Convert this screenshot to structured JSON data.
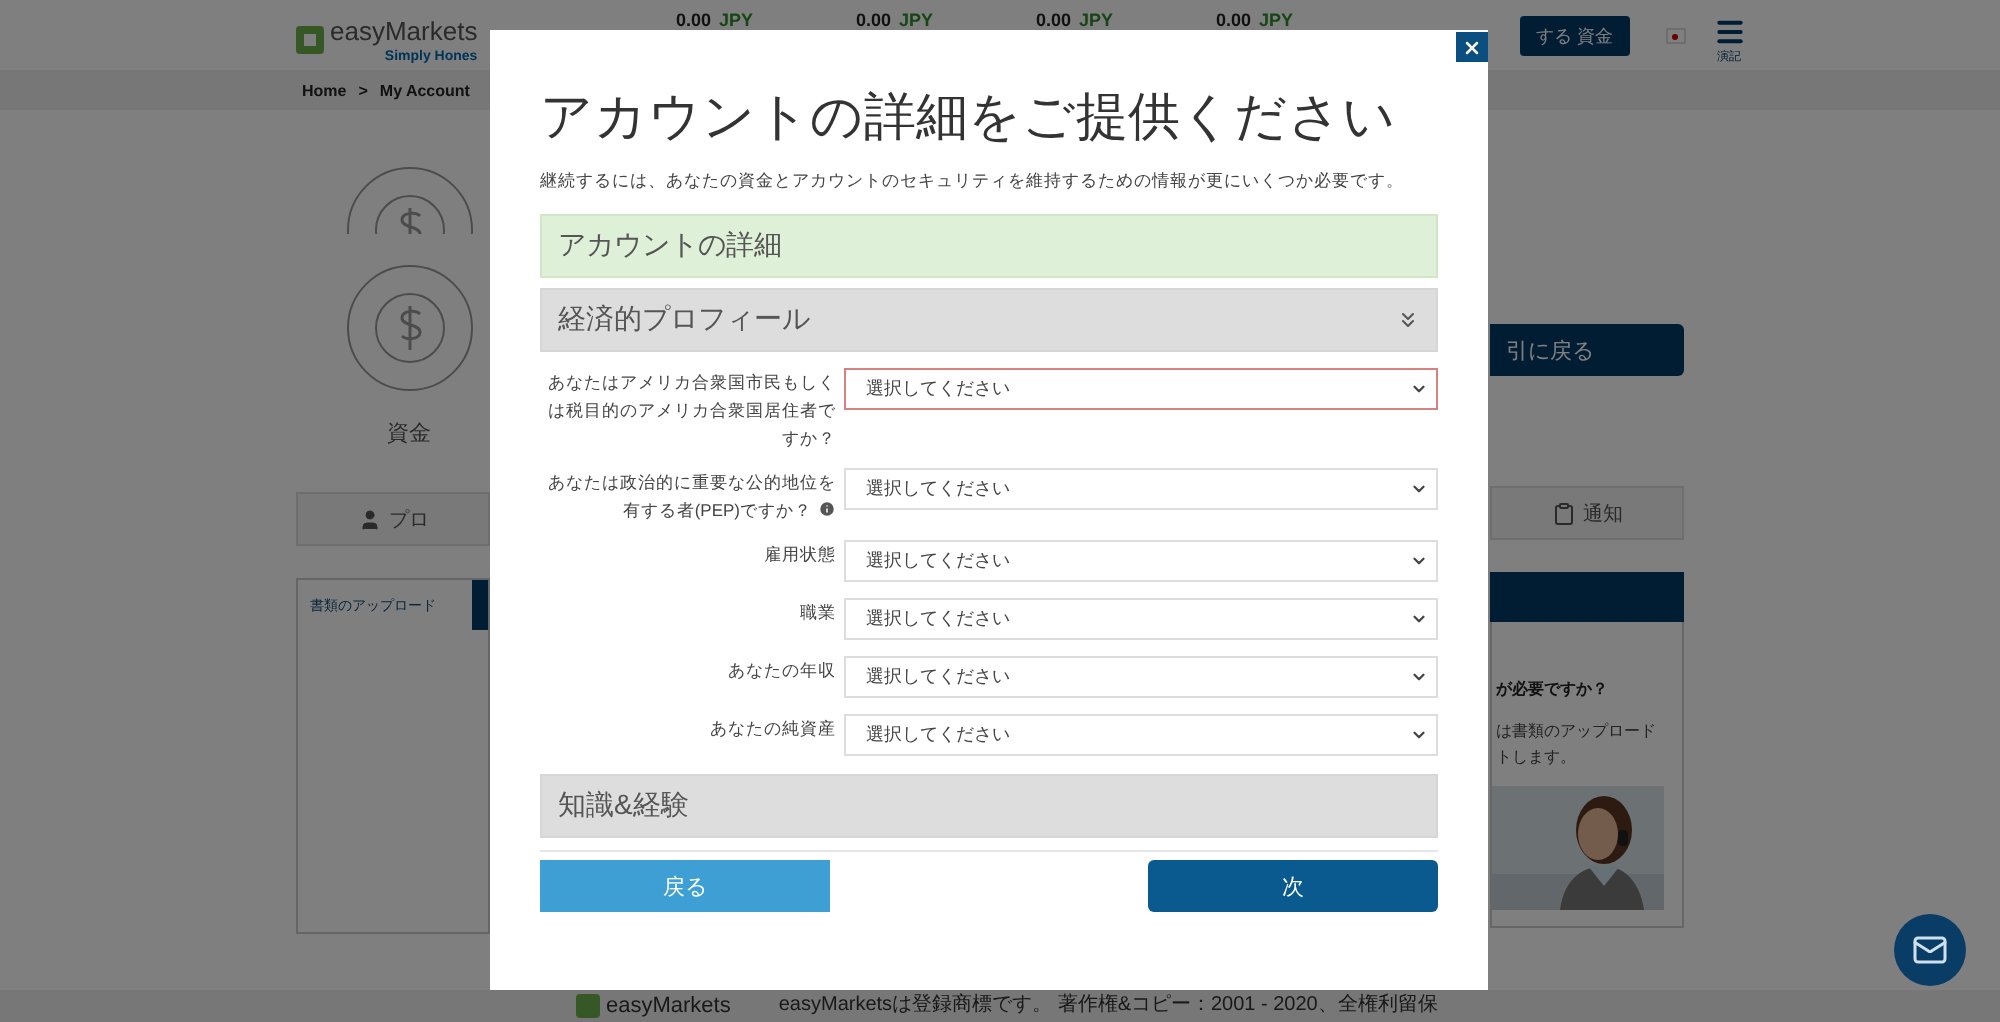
{
  "header": {
    "logo": {
      "name": "easyMarkets",
      "tagline": "Simply Hones"
    },
    "tickers": [
      {
        "value": "0.00",
        "currency": "JPY"
      },
      {
        "value": "0.00",
        "currency": "JPY"
      },
      {
        "value": "0.00",
        "currency": "JPY"
      },
      {
        "value": "0.00",
        "currency": "JPY"
      }
    ],
    "deposit_button": "する 資金",
    "menu_label": "演記"
  },
  "breadcrumb": {
    "items": [
      "Home",
      "My Account"
    ],
    "separator": ">"
  },
  "left": {
    "funds_label": "資金",
    "profile_tab": "プロ",
    "upload_tab": "書類のアップロード"
  },
  "right": {
    "back_button": "引に戻る",
    "notifications_tab": "通知",
    "help_title": "が必要ですか？",
    "help_lines": [
      "は書類のアップロード",
      "トします。"
    ]
  },
  "footer": {
    "logo": "easyMarkets",
    "text": "easyMarketsは登録商標です。 著作権&コピー：2001 - 2020、全権利留保"
  },
  "modal": {
    "title": "アカウントの詳細をご提供ください",
    "intro": "継続するには、あなたの資金とアカウントのセキュリティを維持するための情報が更にいくつか必要です。",
    "sections": [
      {
        "title": "アカウントの詳細",
        "done": true,
        "expanded": false
      },
      {
        "title": "経済的プロフィール",
        "done": false,
        "expanded": true,
        "fields": [
          {
            "label": "あなたはアメリカ合衆国市民もしくは税目的のアメリカ合衆国居住者ですか？",
            "value": "選択してください",
            "invalid": true,
            "info": false
          },
          {
            "label": "あなたは政治的に重要な公的地位を有する者(PEP)ですか？",
            "value": "選択してください",
            "invalid": false,
            "info": true
          },
          {
            "label": "雇用状態",
            "value": "選択してください",
            "invalid": false,
            "info": false
          },
          {
            "label": "職業",
            "value": "選択してください",
            "invalid": false,
            "info": false
          },
          {
            "label": "あなたの年収",
            "value": "選択してください",
            "invalid": false,
            "info": false
          },
          {
            "label": "あなたの純資産",
            "value": "選択してください",
            "invalid": false,
            "info": false
          }
        ]
      },
      {
        "title": "知識&経験",
        "done": false,
        "expanded": false
      }
    ],
    "back_button": "戻る",
    "next_button": "次"
  }
}
